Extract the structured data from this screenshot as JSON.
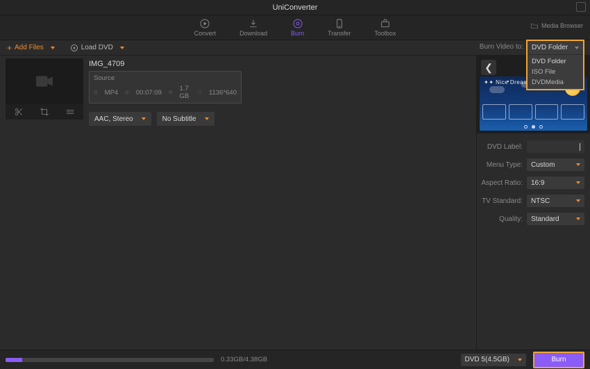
{
  "window": {
    "title": "UniConverter"
  },
  "nav": {
    "items": [
      {
        "label": "Convert"
      },
      {
        "label": "Download"
      },
      {
        "label": "Burn"
      },
      {
        "label": "Transfer"
      },
      {
        "label": "Toolbox"
      }
    ],
    "media_browser": "Media Browser"
  },
  "toolbar": {
    "add_files": "Add Files",
    "load_dvd": "Load DVD",
    "burn_to_label": "Burn Video to:"
  },
  "burn_to": {
    "selected": "DVD Folder",
    "options": [
      "DVD Folder",
      "ISO File",
      "DVDMedia"
    ]
  },
  "file": {
    "name": "IMG_4709",
    "source_label": "Source",
    "format": "MP4",
    "duration": "00:07:09",
    "size": "1.7 GB",
    "resolution": "1136*640",
    "audio_select": "AAC, Stereo",
    "subtitle_select": "No Subtitle"
  },
  "preview": {
    "title": "Nice Dream"
  },
  "settings": {
    "dvd_label": {
      "label": "DVD Label:",
      "value": ""
    },
    "menu_type": {
      "label": "Menu Type:",
      "value": "Custom"
    },
    "aspect_ratio": {
      "label": "Aspect Ratio:",
      "value": "16:9"
    },
    "tv_standard": {
      "label": "TV Standard:",
      "value": "NTSC"
    },
    "quality": {
      "label": "Quality:",
      "value": "Standard"
    }
  },
  "bottom": {
    "size": "0.33GB/4.38GB",
    "disc": "DVD 5(4.5GB)",
    "burn": "Burn"
  }
}
